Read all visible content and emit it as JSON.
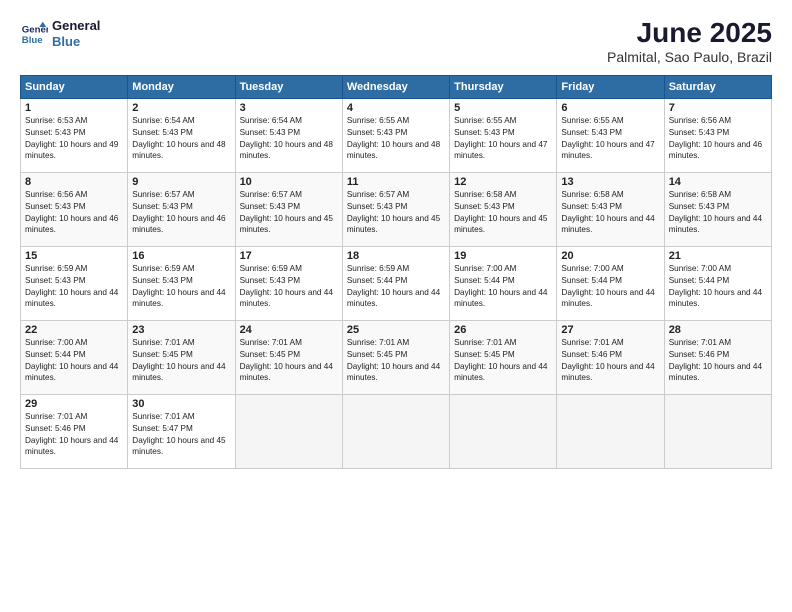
{
  "header": {
    "logo_line1": "General",
    "logo_line2": "Blue",
    "month": "June 2025",
    "location": "Palmital, Sao Paulo, Brazil"
  },
  "weekdays": [
    "Sunday",
    "Monday",
    "Tuesday",
    "Wednesday",
    "Thursday",
    "Friday",
    "Saturday"
  ],
  "weeks": [
    [
      {
        "day": 1,
        "sunrise": "6:53 AM",
        "sunset": "5:43 PM",
        "daylight": "10 hours and 49 minutes."
      },
      {
        "day": 2,
        "sunrise": "6:54 AM",
        "sunset": "5:43 PM",
        "daylight": "10 hours and 48 minutes."
      },
      {
        "day": 3,
        "sunrise": "6:54 AM",
        "sunset": "5:43 PM",
        "daylight": "10 hours and 48 minutes."
      },
      {
        "day": 4,
        "sunrise": "6:55 AM",
        "sunset": "5:43 PM",
        "daylight": "10 hours and 48 minutes."
      },
      {
        "day": 5,
        "sunrise": "6:55 AM",
        "sunset": "5:43 PM",
        "daylight": "10 hours and 47 minutes."
      },
      {
        "day": 6,
        "sunrise": "6:55 AM",
        "sunset": "5:43 PM",
        "daylight": "10 hours and 47 minutes."
      },
      {
        "day": 7,
        "sunrise": "6:56 AM",
        "sunset": "5:43 PM",
        "daylight": "10 hours and 46 minutes."
      }
    ],
    [
      {
        "day": 8,
        "sunrise": "6:56 AM",
        "sunset": "5:43 PM",
        "daylight": "10 hours and 46 minutes."
      },
      {
        "day": 9,
        "sunrise": "6:57 AM",
        "sunset": "5:43 PM",
        "daylight": "10 hours and 46 minutes."
      },
      {
        "day": 10,
        "sunrise": "6:57 AM",
        "sunset": "5:43 PM",
        "daylight": "10 hours and 45 minutes."
      },
      {
        "day": 11,
        "sunrise": "6:57 AM",
        "sunset": "5:43 PM",
        "daylight": "10 hours and 45 minutes."
      },
      {
        "day": 12,
        "sunrise": "6:58 AM",
        "sunset": "5:43 PM",
        "daylight": "10 hours and 45 minutes."
      },
      {
        "day": 13,
        "sunrise": "6:58 AM",
        "sunset": "5:43 PM",
        "daylight": "10 hours and 44 minutes."
      },
      {
        "day": 14,
        "sunrise": "6:58 AM",
        "sunset": "5:43 PM",
        "daylight": "10 hours and 44 minutes."
      }
    ],
    [
      {
        "day": 15,
        "sunrise": "6:59 AM",
        "sunset": "5:43 PM",
        "daylight": "10 hours and 44 minutes."
      },
      {
        "day": 16,
        "sunrise": "6:59 AM",
        "sunset": "5:43 PM",
        "daylight": "10 hours and 44 minutes."
      },
      {
        "day": 17,
        "sunrise": "6:59 AM",
        "sunset": "5:43 PM",
        "daylight": "10 hours and 44 minutes."
      },
      {
        "day": 18,
        "sunrise": "6:59 AM",
        "sunset": "5:44 PM",
        "daylight": "10 hours and 44 minutes."
      },
      {
        "day": 19,
        "sunrise": "7:00 AM",
        "sunset": "5:44 PM",
        "daylight": "10 hours and 44 minutes."
      },
      {
        "day": 20,
        "sunrise": "7:00 AM",
        "sunset": "5:44 PM",
        "daylight": "10 hours and 44 minutes."
      },
      {
        "day": 21,
        "sunrise": "7:00 AM",
        "sunset": "5:44 PM",
        "daylight": "10 hours and 44 minutes."
      }
    ],
    [
      {
        "day": 22,
        "sunrise": "7:00 AM",
        "sunset": "5:44 PM",
        "daylight": "10 hours and 44 minutes."
      },
      {
        "day": 23,
        "sunrise": "7:01 AM",
        "sunset": "5:45 PM",
        "daylight": "10 hours and 44 minutes."
      },
      {
        "day": 24,
        "sunrise": "7:01 AM",
        "sunset": "5:45 PM",
        "daylight": "10 hours and 44 minutes."
      },
      {
        "day": 25,
        "sunrise": "7:01 AM",
        "sunset": "5:45 PM",
        "daylight": "10 hours and 44 minutes."
      },
      {
        "day": 26,
        "sunrise": "7:01 AM",
        "sunset": "5:45 PM",
        "daylight": "10 hours and 44 minutes."
      },
      {
        "day": 27,
        "sunrise": "7:01 AM",
        "sunset": "5:46 PM",
        "daylight": "10 hours and 44 minutes."
      },
      {
        "day": 28,
        "sunrise": "7:01 AM",
        "sunset": "5:46 PM",
        "daylight": "10 hours and 44 minutes."
      }
    ],
    [
      {
        "day": 29,
        "sunrise": "7:01 AM",
        "sunset": "5:46 PM",
        "daylight": "10 hours and 44 minutes."
      },
      {
        "day": 30,
        "sunrise": "7:01 AM",
        "sunset": "5:47 PM",
        "daylight": "10 hours and 45 minutes."
      },
      null,
      null,
      null,
      null,
      null
    ]
  ]
}
